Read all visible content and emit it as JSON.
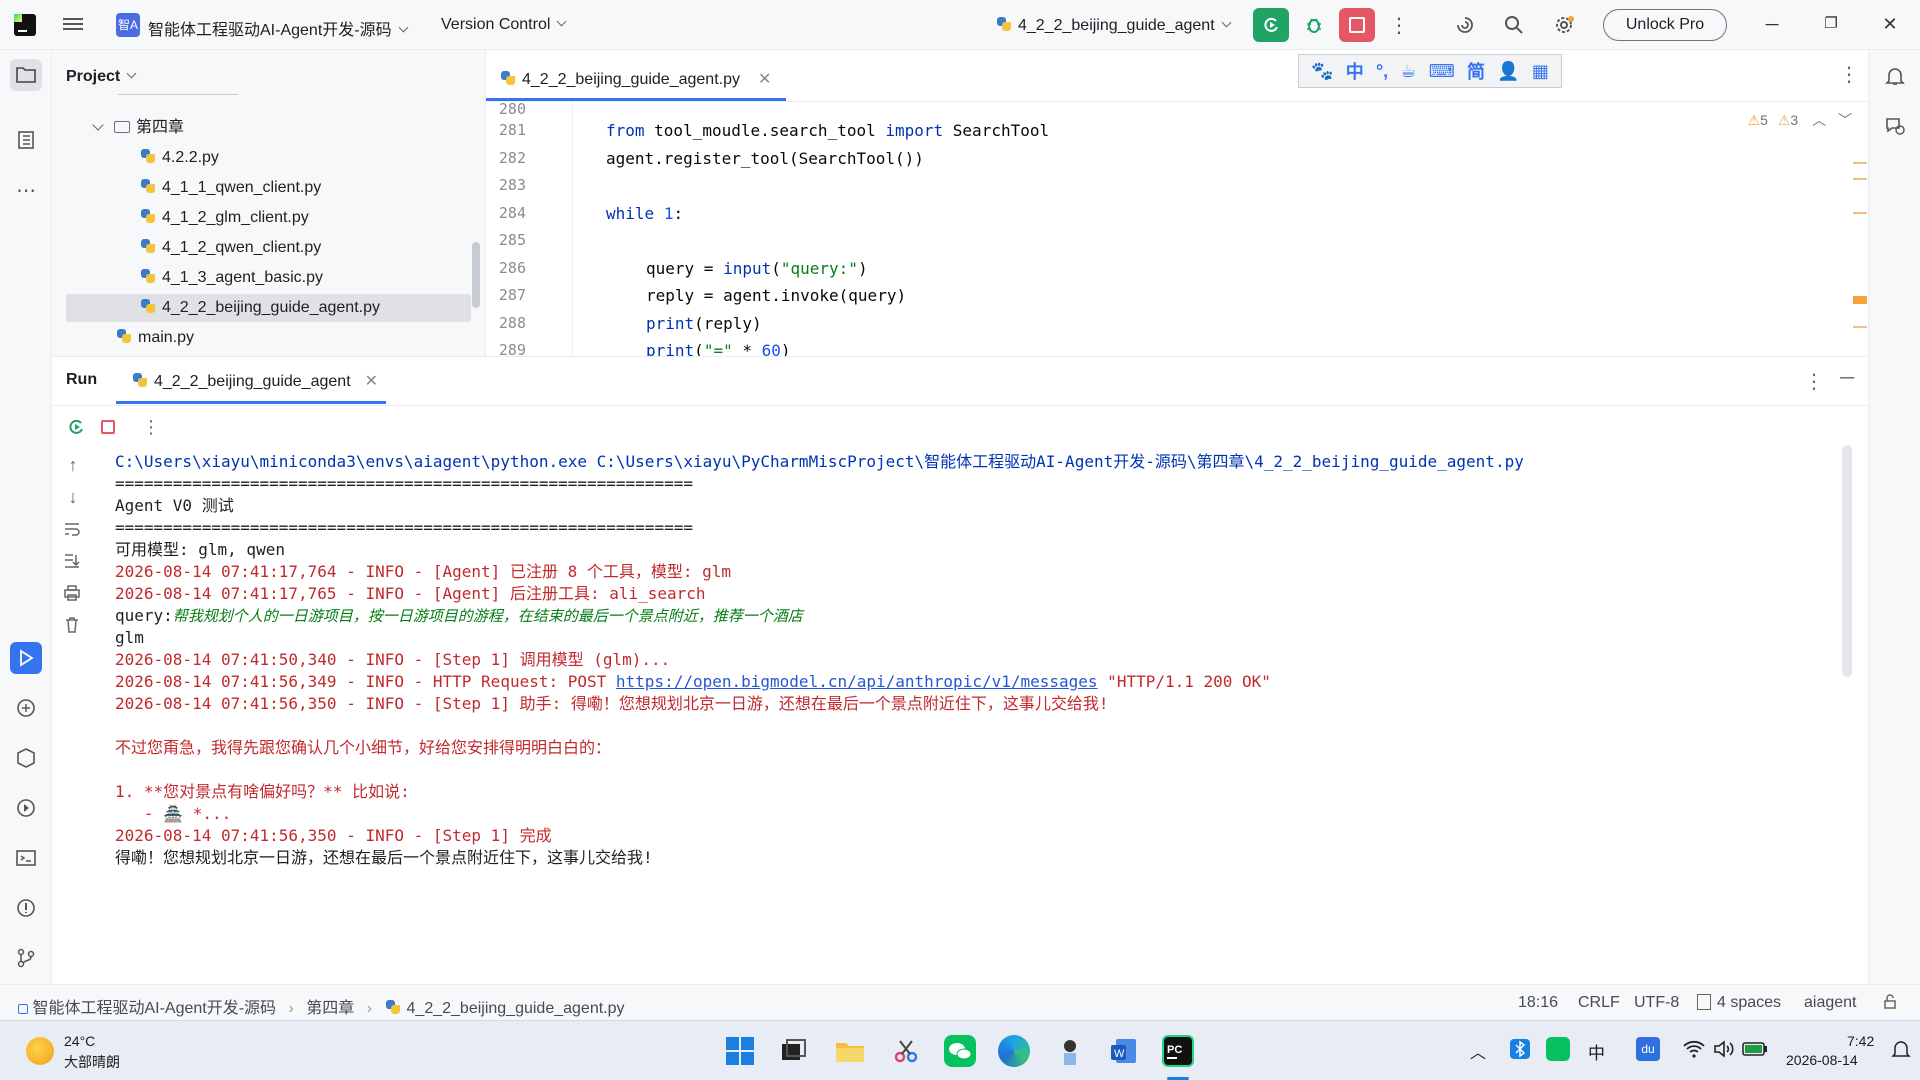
{
  "titlebar": {
    "project_badge": "智A",
    "project_name": "智能体工程驱动AI-Agent开发-源码",
    "vcs": "Version Control",
    "run_config": "4_2_2_beijing_guide_agent",
    "unlock": "Unlock Pro"
  },
  "project": {
    "title": "Project",
    "items": [
      {
        "type": "folder",
        "label": "第四章"
      },
      {
        "type": "py",
        "label": "4.2.2.py"
      },
      {
        "type": "py",
        "label": "4_1_1_qwen_client.py"
      },
      {
        "type": "py",
        "label": "4_1_2_glm_client.py"
      },
      {
        "type": "py",
        "label": "4_1_2_qwen_client.py"
      },
      {
        "type": "py",
        "label": "4_1_3_agent_basic.py"
      },
      {
        "type": "py",
        "label": "4_2_2_beijing_guide_agent.py"
      },
      {
        "type": "py",
        "label": "main.py"
      }
    ]
  },
  "editor": {
    "tab": "4_2_2_beijing_guide_agent.py",
    "ime": [
      "🐾",
      "中",
      "°,",
      "☕",
      "⌨",
      "简",
      "👤",
      "▦"
    ],
    "warnings": {
      "a": "5",
      "b": "3"
    },
    "line_numbers": [
      "280",
      "281",
      "282",
      "283",
      "284",
      "285",
      "286",
      "287",
      "288",
      "289"
    ]
  },
  "run": {
    "title": "Run",
    "tab": "4_2_2_beijing_guide_agent",
    "console": [
      {
        "cls": "c-cmd",
        "text": "C:\\Users\\xiayu\\miniconda3\\envs\\aiagent\\python.exe C:\\Users\\xiayu\\PyCharmMiscProject\\智能体工程驱动AI-Agent开发-源码\\第四章\\4_2_2_beijing_guide_agent.py"
      },
      {
        "cls": "",
        "text": "============================================================"
      },
      {
        "cls": "",
        "text": "Agent V0 测试"
      },
      {
        "cls": "",
        "text": "============================================================"
      },
      {
        "cls": "",
        "text": "可用模型: glm, qwen"
      },
      {
        "cls": "c-red",
        "text": "2026-08-14 07:41:17,764 - INFO - [Agent] 已注册 8 个工具，模型: glm"
      },
      {
        "cls": "c-red",
        "text": "2026-08-14 07:41:17,765 - INFO - [Agent] 后注册工具: ali_search"
      },
      {
        "cls": "query",
        "text": "query:"
      },
      {
        "cls": "",
        "text": "glm"
      },
      {
        "cls": "c-red",
        "text": "2026-08-14 07:41:50,340 - INFO - [Step 1] 调用模型 (glm)..."
      },
      {
        "cls": "http",
        "text": ""
      },
      {
        "cls": "c-red",
        "text": "2026-08-14 07:41:56,350 - INFO - [Step 1] 助手: 得嘞！您想规划北京一日游，还想在最后一个景点附近住下，这事儿交给我!"
      },
      {
        "cls": "",
        "text": ""
      },
      {
        "cls": "c-red",
        "text": "不过您甭急，我得先跟您确认几个小细节，好给您安排得明明白白的："
      },
      {
        "cls": "",
        "text": ""
      },
      {
        "cls": "c-red",
        "text": "1. **您对景点有啥偏好吗？** 比如说:"
      },
      {
        "cls": "c-red",
        "text": "   - 🏯 *..."
      },
      {
        "cls": "c-red",
        "text": "2026-08-14 07:41:56,350 - INFO - [Step 1] 完成"
      },
      {
        "cls": "",
        "text": "得嘞！您想规划北京一日游，还想在最后一个景点附近住下，这事儿交给我!"
      }
    ],
    "query_text": "帮我规划个人的一日游项目，按一日游项目的游程，在结束的最后一个景点附近，推荐一个酒店",
    "http_prefix": "2026-08-14 07:41:56,349 - INFO - HTTP Request: POST ",
    "http_link": "https://open.bigmodel.cn/api/anthropic/v1/messages",
    "http_suffix": " \"HTTP/1.1 200 OK\""
  },
  "status": {
    "crumb1": "智能体工程驱动AI-Agent开发-源码",
    "crumb2": "第四章",
    "crumb3": "4_2_2_beijing_guide_agent.py",
    "pos": "18:16",
    "crlf": "CRLF",
    "enc": "UTF-8",
    "indent": "4 spaces",
    "interp": "aiagent"
  },
  "taskbar": {
    "temp": "24°C",
    "weather": "大部晴朗",
    "ime_lang": "中",
    "time": "7:42",
    "date": "2026-08-14"
  },
  "colors": {
    "accent": "#3574f0",
    "green_run": "#21a366",
    "stop": "#e55765"
  }
}
